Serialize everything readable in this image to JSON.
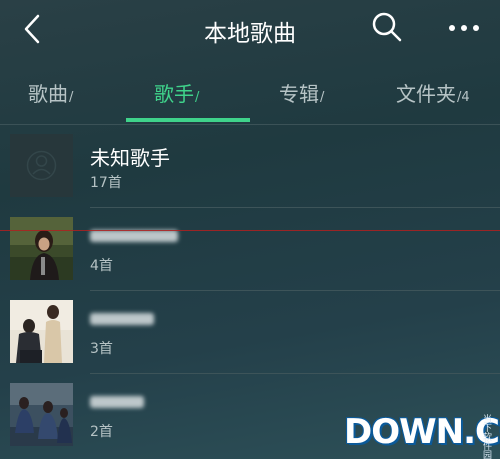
{
  "header": {
    "title": "本地歌曲",
    "icons": [
      "back-icon",
      "search-icon",
      "more-icon"
    ]
  },
  "tabs": [
    {
      "label": "歌曲",
      "count": "/",
      "active": false
    },
    {
      "label": "歌手",
      "count": "/",
      "active": true
    },
    {
      "label": "专辑",
      "count": "/",
      "active": false
    },
    {
      "label": "文件夹",
      "count": "/4",
      "active": false
    }
  ],
  "artists": [
    {
      "name": "未知歌手",
      "count": "17首"
    },
    {
      "name": "",
      "count": "4首"
    },
    {
      "name": "",
      "count": "3首"
    },
    {
      "name": "",
      "count": "2首"
    }
  ],
  "watermark": {
    "logo": "DOWN.CC",
    "side_text": "当下软件园"
  },
  "colors": {
    "accent": "#3fd38b",
    "background": "#24404a",
    "annotation_line": "#b02020"
  }
}
